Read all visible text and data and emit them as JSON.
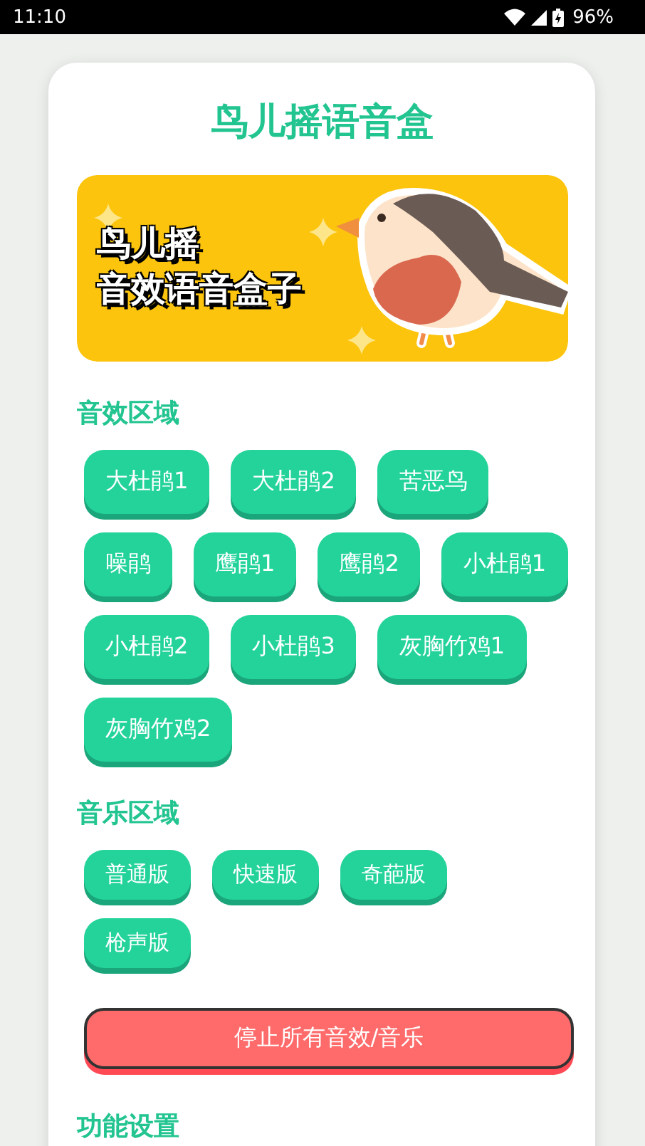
{
  "status_bar": {
    "time": "11:10",
    "battery": "96%"
  },
  "title": "鸟儿摇语音盒",
  "banner": {
    "title_lines": [
      "鸟儿摇",
      "音效语音盒子"
    ]
  },
  "sections": [
    {
      "kind": "sounds",
      "heading": "音效区域",
      "buttons": [
        "大杜鹃1",
        "大杜鹃2",
        "苦恶鸟",
        "噪鹃",
        "鹰鹃1",
        "鹰鹃2",
        "小杜鹃1",
        "小杜鹃2",
        "小杜鹃3",
        "灰胸竹鸡1",
        "灰胸竹鸡2"
      ]
    },
    {
      "kind": "music",
      "heading": "音乐区域",
      "buttons": [
        "普通版",
        "快速版",
        "奇葩版",
        "枪声版"
      ]
    }
  ],
  "stop_button": "停止所有音效/音乐",
  "settings_heading": "功能设置"
}
